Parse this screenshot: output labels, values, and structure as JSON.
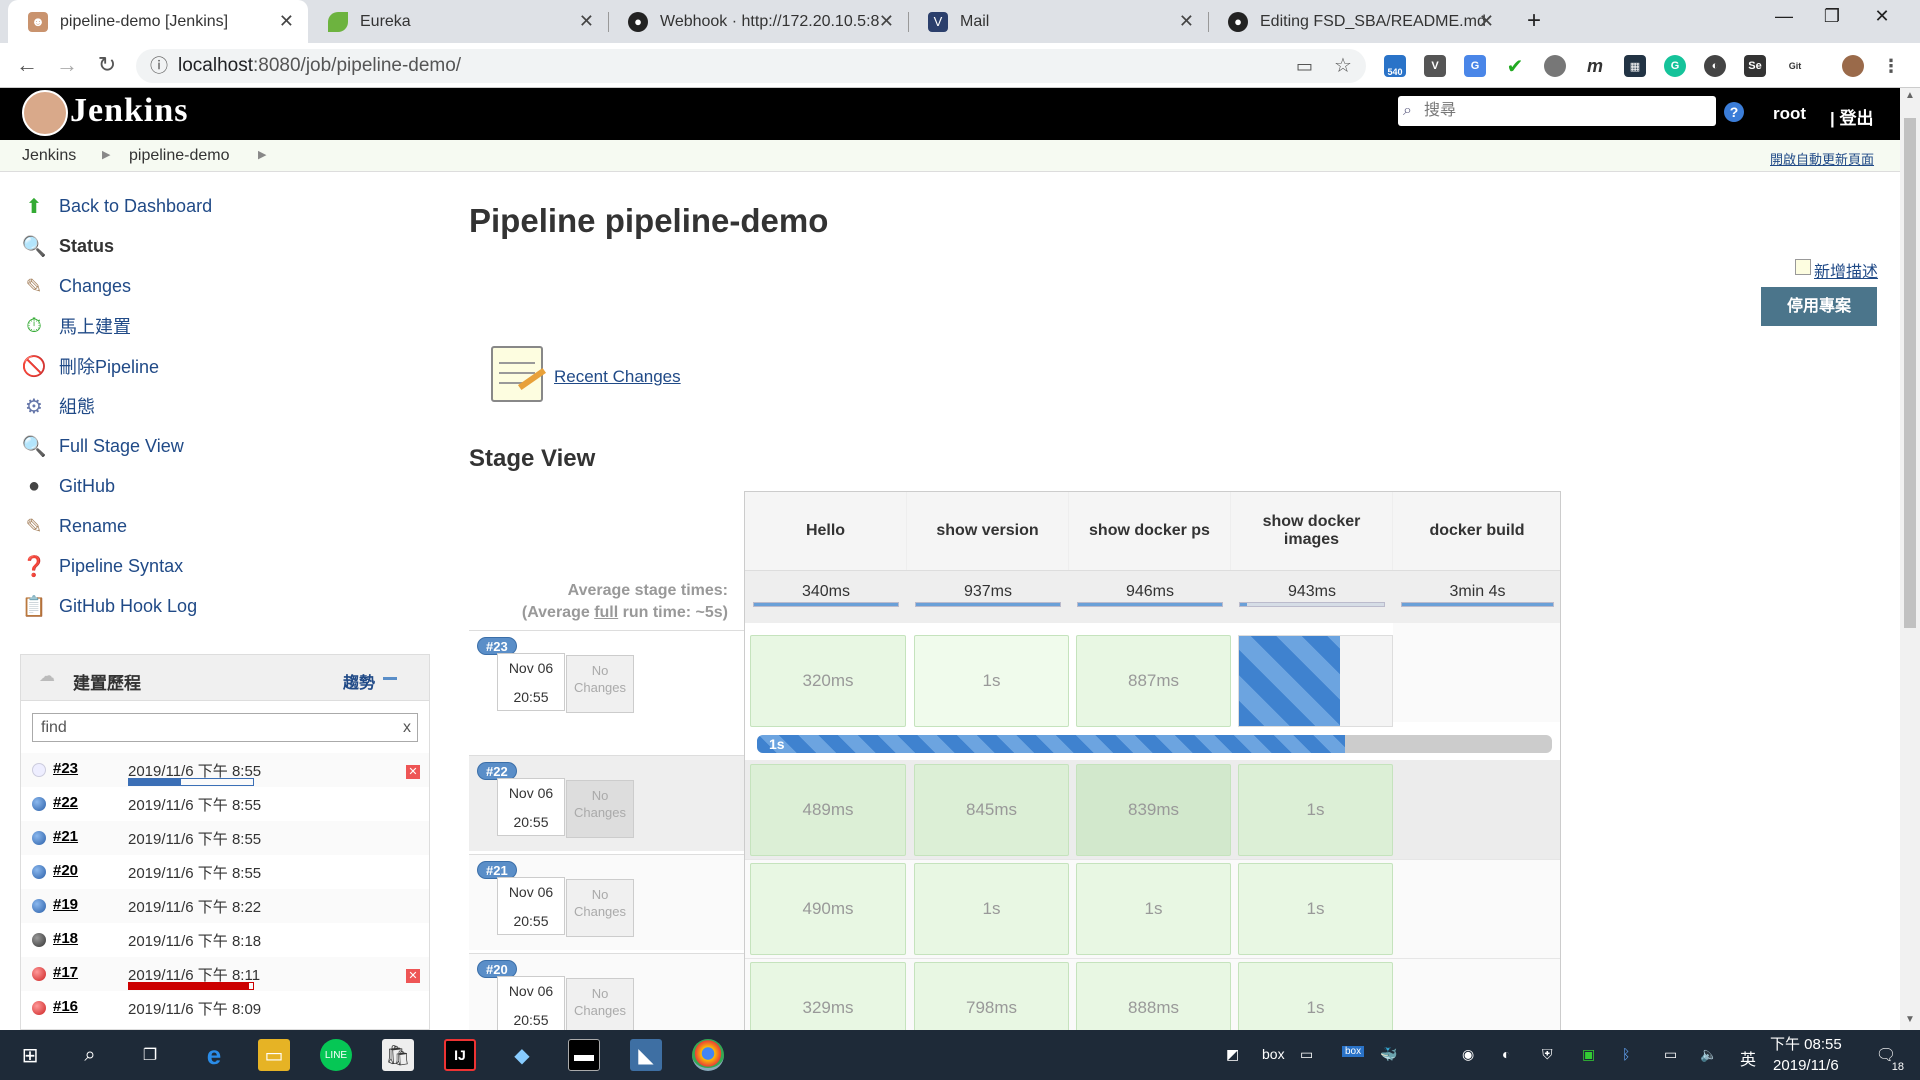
{
  "browser": {
    "tabs": [
      {
        "title": "pipeline-demo [Jenkins]",
        "favicon": "jenkins-icon",
        "active": true
      },
      {
        "title": "Eureka",
        "favicon": "spring-leaf-icon",
        "active": false
      },
      {
        "title": "Webhook · http://172.20.10.5:8",
        "favicon": "github-icon",
        "active": false
      },
      {
        "title": "Mail",
        "favicon": "mail-icon",
        "active": false
      },
      {
        "title": "Editing FSD_SBA/README.md",
        "favicon": "github-icon",
        "active": false
      }
    ],
    "new_tab": "+",
    "url_host": "localhost",
    "url_path": ":8080/job/pipeline-demo/",
    "ext_badge": "540"
  },
  "jenkins": {
    "brand": "Jenkins",
    "search_placeholder": "搜尋",
    "help": "?",
    "user": "root",
    "logout": "| 登出",
    "breadcrumb": [
      "Jenkins",
      "pipeline-demo"
    ],
    "auto_refresh": "開啟自動更新頁面"
  },
  "sidebar": [
    {
      "label": "Back to Dashboard",
      "icon": "up-arrow-icon"
    },
    {
      "label": "Status",
      "icon": "magnifier-icon"
    },
    {
      "label": "Changes",
      "icon": "notepad-icon"
    },
    {
      "label": "馬上建置",
      "icon": "build-clock-icon"
    },
    {
      "label": "刪除Pipeline",
      "icon": "no-entry-icon"
    },
    {
      "label": "組態",
      "icon": "gear-icon"
    },
    {
      "label": "Full Stage View",
      "icon": "magnifier-icon"
    },
    {
      "label": "GitHub",
      "icon": "github-icon"
    },
    {
      "label": "Rename",
      "icon": "notepad-icon"
    },
    {
      "label": "Pipeline Syntax",
      "icon": "help-icon"
    },
    {
      "label": "GitHub Hook Log",
      "icon": "clipboard-icon"
    }
  ],
  "build_history": {
    "title": "建置歷程",
    "trend": "趨勢",
    "find": "find",
    "clear": "x",
    "builds": [
      {
        "num": "#23",
        "date": "2019/11/6 下午 8:55",
        "status": "running",
        "progress": 0.42
      },
      {
        "num": "#22",
        "date": "2019/11/6 下午 8:55",
        "status": "success"
      },
      {
        "num": "#21",
        "date": "2019/11/6 下午 8:55",
        "status": "success"
      },
      {
        "num": "#20",
        "date": "2019/11/6 下午 8:55",
        "status": "success"
      },
      {
        "num": "#19",
        "date": "2019/11/6 下午 8:22",
        "status": "success"
      },
      {
        "num": "#18",
        "date": "2019/11/6 下午 8:18",
        "status": "aborted"
      },
      {
        "num": "#17",
        "date": "2019/11/6 下午 8:11",
        "status": "failed",
        "progress": 0.97
      },
      {
        "num": "#16",
        "date": "2019/11/6 下午 8:09",
        "status": "failed"
      }
    ]
  },
  "main": {
    "title": "Pipeline pipeline-demo",
    "add_description": "新增描述",
    "disable_button": "停用專案",
    "recent_changes": "Recent Changes",
    "stage_view_title": "Stage View",
    "avg_label_1": "Average stage times:",
    "avg_label_2a": "(Average ",
    "avg_label_2b": "full",
    "avg_label_2c": " run time: ~5s)",
    "stages": [
      {
        "name": "Hello",
        "avg": "340ms",
        "avg_fill": 1.0
      },
      {
        "name": "show version",
        "avg": "937ms",
        "avg_fill": 1.0
      },
      {
        "name": "show docker ps",
        "avg": "946ms",
        "avg_fill": 1.0
      },
      {
        "name": "show docker images",
        "avg": "943ms",
        "avg_fill": 0.05
      },
      {
        "name": "docker build",
        "avg": "3min 4s",
        "avg_fill": 1.0
      }
    ],
    "runs": [
      {
        "num": "#23",
        "date": "Nov 06",
        "time": "20:55",
        "changes": "No Changes",
        "cells": [
          "320ms",
          "1s",
          "887ms",
          "",
          ""
        ],
        "running_stage": 3,
        "running_progress": 0.66,
        "bar_label": "1s",
        "bar_progress": 0.74
      },
      {
        "num": "#22",
        "date": "Nov 06",
        "time": "20:55",
        "changes": "No Changes",
        "cells": [
          "489ms",
          "845ms",
          "839ms",
          "1s",
          ""
        ]
      },
      {
        "num": "#21",
        "date": "Nov 06",
        "time": "20:55",
        "changes": "No Changes",
        "cells": [
          "490ms",
          "1s",
          "1s",
          "1s",
          ""
        ]
      },
      {
        "num": "#20",
        "date": "Nov 06",
        "time": "20:55",
        "changes": "No Changes",
        "cells": [
          "329ms",
          "798ms",
          "888ms",
          "1s",
          ""
        ]
      }
    ]
  },
  "taskbar": {
    "tray": [
      "box",
      "英"
    ],
    "time": "下午 08:55",
    "date": "2019/11/6",
    "notifications": "18"
  }
}
